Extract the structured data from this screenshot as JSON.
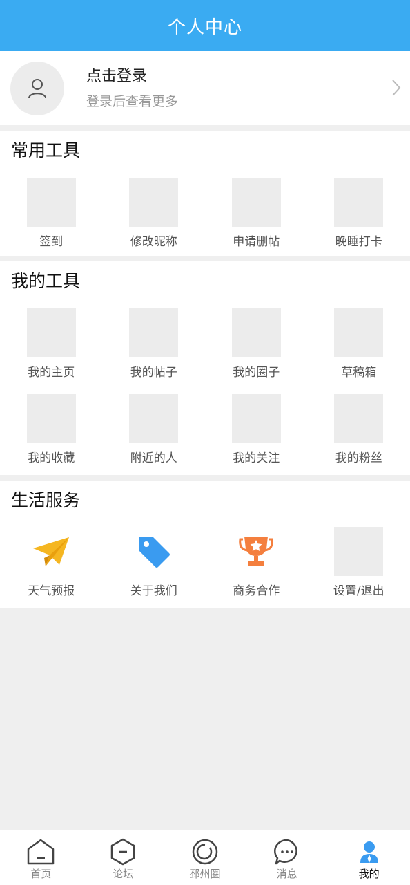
{
  "header": {
    "title": "个人中心"
  },
  "profile": {
    "title": "点击登录",
    "subtitle": "登录后查看更多"
  },
  "common_tools": {
    "title": "常用工具",
    "items": [
      {
        "label": "签到"
      },
      {
        "label": "修改昵称"
      },
      {
        "label": "申请删帖"
      },
      {
        "label": "晚睡打卡"
      }
    ]
  },
  "my_tools": {
    "title": "我的工具",
    "items": [
      {
        "label": "我的主页"
      },
      {
        "label": "我的帖子"
      },
      {
        "label": "我的圈子"
      },
      {
        "label": "草稿箱"
      },
      {
        "label": "我的收藏"
      },
      {
        "label": "附近的人"
      },
      {
        "label": "我的关注"
      },
      {
        "label": "我的粉丝"
      }
    ]
  },
  "life_services": {
    "title": "生活服务",
    "items": [
      {
        "label": "天气预报",
        "icon": "paper-plane-icon",
        "color": "#f5b621"
      },
      {
        "label": "关于我们",
        "icon": "tag-icon",
        "color": "#3a9bf0"
      },
      {
        "label": "商务合作",
        "icon": "trophy-icon",
        "color": "#f47f3e"
      },
      {
        "label": "设置/退出",
        "icon": ""
      }
    ]
  },
  "tabbar": {
    "items": [
      {
        "label": "首页",
        "icon": "home-icon"
      },
      {
        "label": "论坛",
        "icon": "forum-icon"
      },
      {
        "label": "邳州圈",
        "icon": "circle-icon"
      },
      {
        "label": "消息",
        "icon": "message-icon"
      },
      {
        "label": "我的",
        "icon": "user-icon",
        "active": true
      }
    ]
  },
  "colors": {
    "accent": "#3aabf2",
    "background": "#efefef"
  }
}
